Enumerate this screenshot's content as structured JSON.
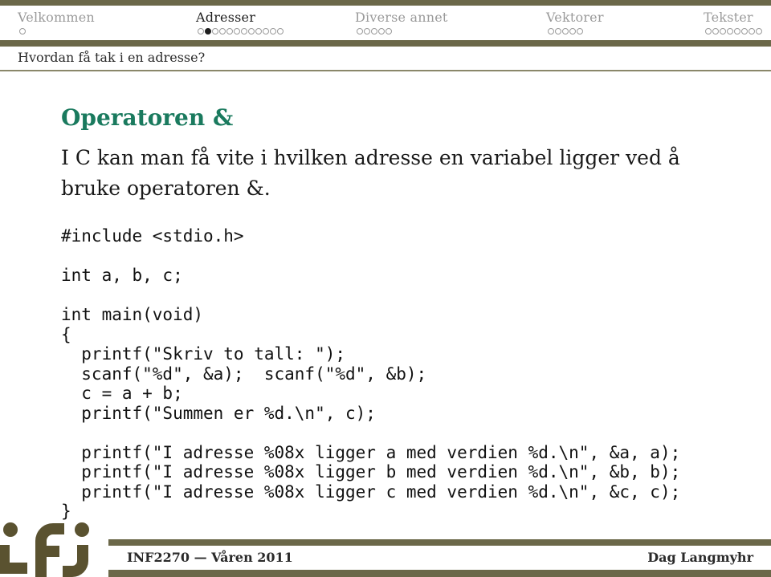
{
  "nav": {
    "sections": [
      {
        "label": "Velkommen",
        "dots": 1,
        "current": -1,
        "active": false
      },
      {
        "label": "Adresser",
        "dots": 12,
        "current": 1,
        "active": true
      },
      {
        "label": "Diverse annet",
        "dots": 5,
        "current": -1,
        "active": false
      },
      {
        "label": "Vektorer",
        "dots": 5,
        "current": -1,
        "active": false
      },
      {
        "label": "Tekster",
        "dots": 8,
        "current": -1,
        "active": false
      }
    ]
  },
  "subsection": "Hvordan få tak i en adresse?",
  "slide": {
    "title": "Operatoren &",
    "intro": "I C kan man få vite i hvilken adresse en variabel ligger ved å bruke operatoren &.",
    "code": "#include <stdio.h>\n\nint a, b, c;\n\nint main(void)\n{\n  printf(\"Skriv to tall: \");\n  scanf(\"%d\", &a);  scanf(\"%d\", &b);\n  c = a + b;\n  printf(\"Summen er %d.\\n\", c);\n\n  printf(\"I adresse %08x ligger a med verdien %d.\\n\", &a, a);\n  printf(\"I adresse %08x ligger b med verdien %d.\\n\", &b, b);\n  printf(\"I adresse %08x ligger c med verdien %d.\\n\", &c, c);\n}"
  },
  "footer": {
    "course": "INF2270 — Våren 2011",
    "author": "Dag Langmyhr",
    "logo": "ifi-logo"
  },
  "colors": {
    "bar": "#6b6849",
    "title": "#1a7a5e",
    "inactive_nav": "#9a9a9a"
  }
}
